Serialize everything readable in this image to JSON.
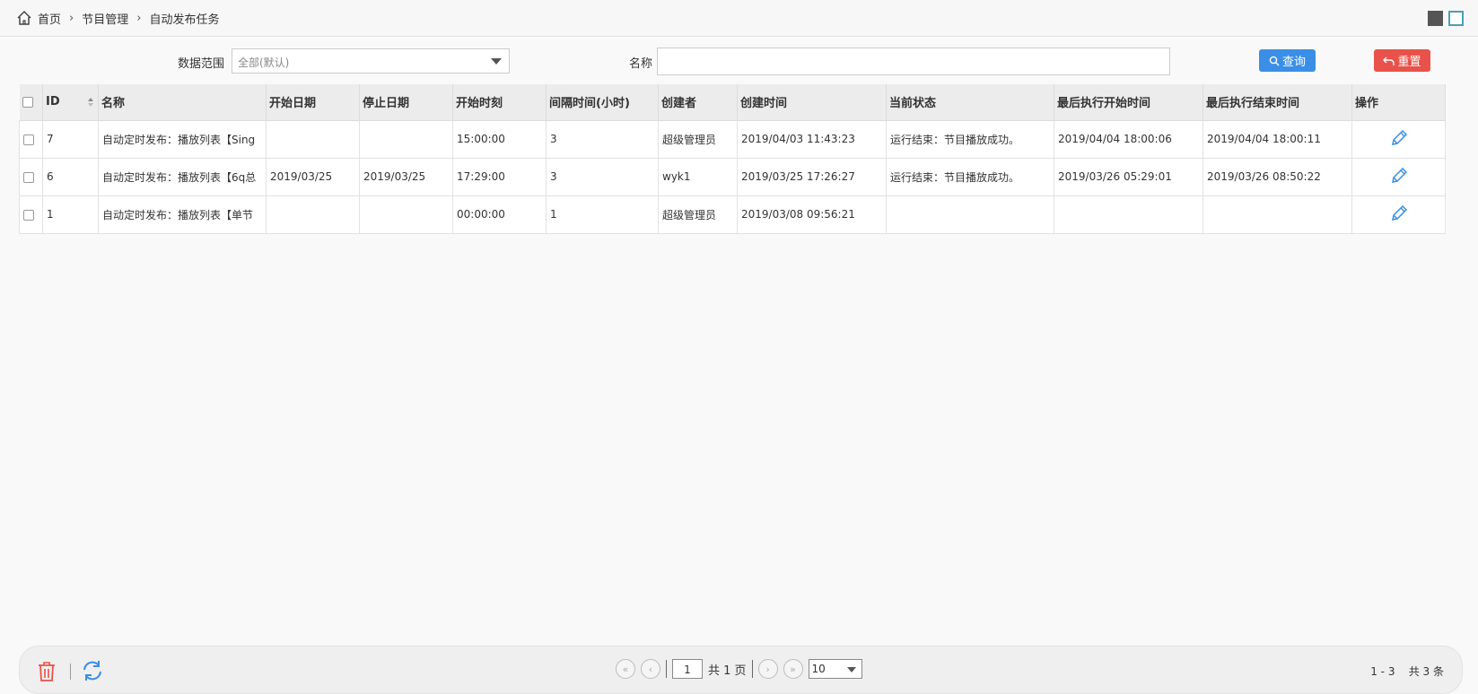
{
  "breadcrumb": {
    "items": [
      "首页",
      "节目管理",
      "自动发布任务"
    ]
  },
  "filter": {
    "range_label": "数据范围",
    "range_value": "全部(默认)",
    "name_label": "名称",
    "name_value": "",
    "query_label": "查询",
    "reset_label": "重置"
  },
  "table": {
    "headers": [
      "ID",
      "名称",
      "开始日期",
      "停止日期",
      "开始时刻",
      "间隔时间(小时)",
      "创建者",
      "创建时间",
      "当前状态",
      "最后执行开始时间",
      "最后执行结束时间",
      "操作"
    ],
    "rows": [
      {
        "id": "7",
        "name": "自动定时发布：播放列表【Sing",
        "start_date": "",
        "stop_date": "",
        "start_time": "15:00:00",
        "interval": "3",
        "creator": "超级管理员",
        "created": "2019/04/03 11:43:23",
        "status": "运行结束：节目播放成功。",
        "last_start": "2019/04/04 18:00:06",
        "last_end": "2019/04/04 18:00:11"
      },
      {
        "id": "6",
        "name": "自动定时发布：播放列表【6q总",
        "start_date": "2019/03/25",
        "stop_date": "2019/03/25",
        "start_time": "17:29:00",
        "interval": "3",
        "creator": "wyk1",
        "created": "2019/03/25 17:26:27",
        "status": "运行结束：节目播放成功。",
        "last_start": "2019/03/26 05:29:01",
        "last_end": "2019/03/26 08:50:22"
      },
      {
        "id": "1",
        "name": "自动定时发布：播放列表【单节",
        "start_date": "",
        "stop_date": "",
        "start_time": "00:00:00",
        "interval": "1",
        "creator": "超级管理员",
        "created": "2019/03/08 09:56:21",
        "status": "",
        "last_start": "",
        "last_end": ""
      }
    ]
  },
  "pager": {
    "current_page": "1",
    "total_pages": "共 1 页",
    "page_size": "10",
    "range": "1 - 3",
    "total": "共 3 条"
  },
  "colors": {
    "query_button": "#3a8ee6",
    "reset_button": "#e8524a",
    "edit_icon": "#3a8ee6",
    "trash_icon": "#e8524a",
    "refresh_icon": "#3a8ee6"
  }
}
